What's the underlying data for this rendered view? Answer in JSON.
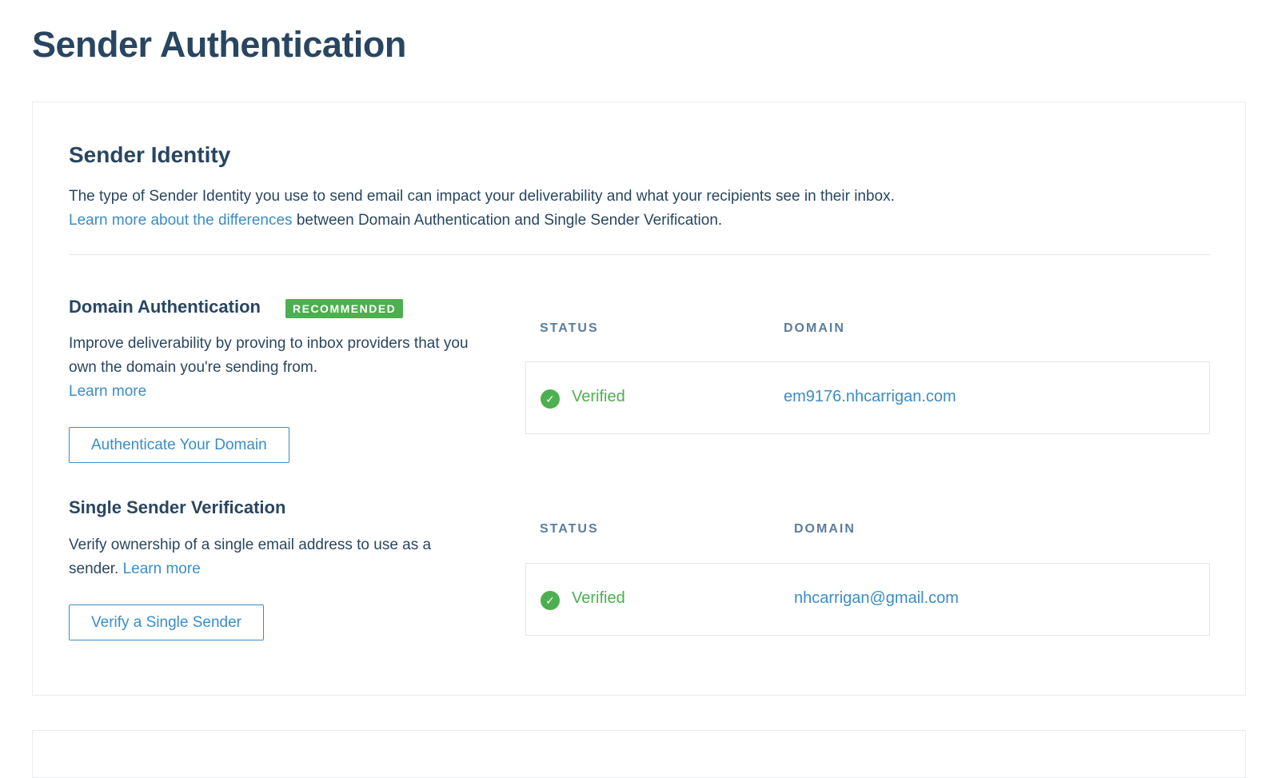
{
  "page": {
    "title": "Sender Authentication"
  },
  "sender_identity": {
    "title": "Sender Identity",
    "intro_line1": "The type of Sender Identity you use to send email can impact your deliverability and what your recipients see in their inbox.",
    "intro_link": "Learn more about the differences",
    "intro_line2_rest": " between Domain Authentication and Single Sender Verification."
  },
  "domain_auth": {
    "title": "Domain Authentication",
    "badge": "RECOMMENDED",
    "description": "Improve deliverability by proving to inbox providers that you own the domain you're sending from.",
    "learn_more": "Learn more",
    "button_label": "Authenticate Your Domain",
    "table": {
      "status_header": "STATUS",
      "domain_header": "DOMAIN",
      "status": "Verified",
      "domain": "em9176.nhcarrigan.com"
    }
  },
  "single_sender": {
    "title": "Single Sender Verification",
    "description": "Verify ownership of a single email address to use as a sender.",
    "learn_more": "Learn more",
    "button_label": "Verify a Single Sender",
    "table": {
      "status_header": "STATUS",
      "domain_header": "DOMAIN",
      "status": "Verified",
      "domain": "nhcarrigan@gmail.com"
    }
  },
  "icons": {
    "verified": "check-circle-icon"
  },
  "colors": {
    "heading": "#294661",
    "link": "#3a8dc8",
    "success": "#4caf50",
    "column_header": "#5b7e9c"
  }
}
